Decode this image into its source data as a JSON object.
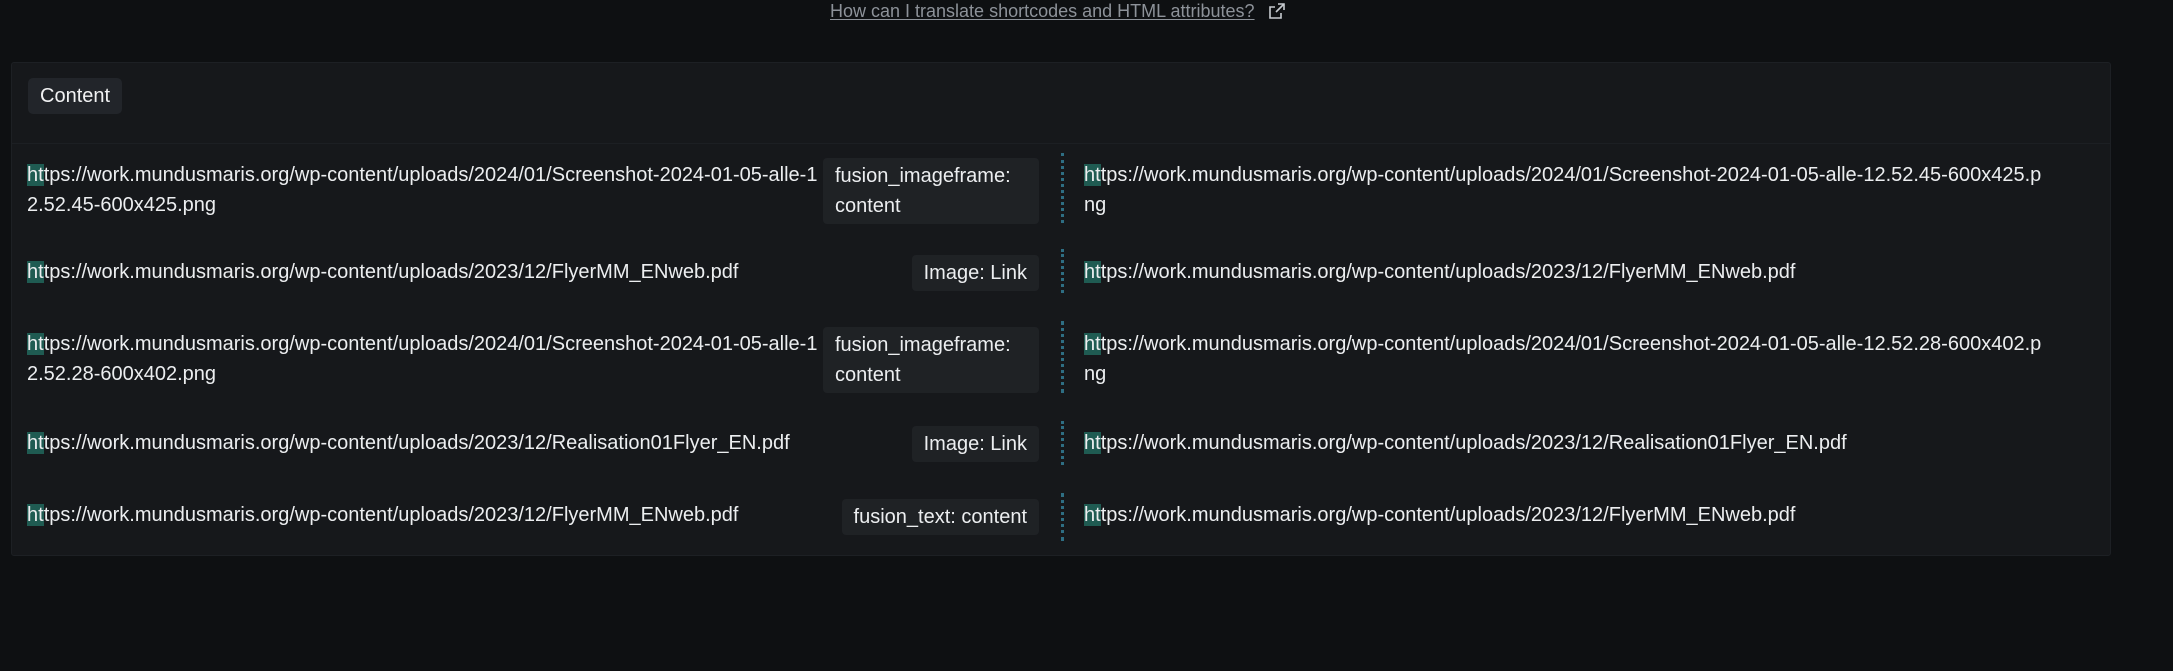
{
  "help": {
    "link_text": "How can I translate shortcodes and HTML attributes?",
    "icon": "external-link-icon"
  },
  "panel": {
    "chip_label": "Content"
  },
  "rows": [
    {
      "source": "https://work.mundusmaris.org/wp-content/uploads/2024/01/Screenshot-2024-01-05-alle-12.52.45-600x425.png",
      "context": "fusion_imageframe: content",
      "target": "https://work.mundusmaris.org/wp-content/uploads/2024/01/Screenshot-2024-01-05-alle-12.52.45-600x425.png"
    },
    {
      "source": "https://work.mundusmaris.org/wp-content/uploads/2023/12/FlyerMM_ENweb.pdf",
      "context": "Image: Link",
      "target": "https://work.mundusmaris.org/wp-content/uploads/2023/12/FlyerMM_ENweb.pdf"
    },
    {
      "source": "https://work.mundusmaris.org/wp-content/uploads/2024/01/Screenshot-2024-01-05-alle-12.52.28-600x402.png",
      "context": "fusion_imageframe: content",
      "target": "https://work.mundusmaris.org/wp-content/uploads/2024/01/Screenshot-2024-01-05-alle-12.52.28-600x402.png"
    },
    {
      "source": "https://work.mundusmaris.org/wp-content/uploads/2023/12/Realisation01Flyer_EN.pdf",
      "context": "Image: Link",
      "target": "https://work.mundusmaris.org/wp-content/uploads/2023/12/Realisation01Flyer_EN.pdf"
    },
    {
      "source": "https://work.mundusmaris.org/wp-content/uploads/2023/12/FlyerMM_ENweb.pdf",
      "context": "fusion_text: content",
      "target": "https://work.mundusmaris.org/wp-content/uploads/2023/12/FlyerMM_ENweb.pdf"
    }
  ],
  "colors": {
    "background": "#0e1012",
    "panel": "#16181b",
    "highlight": "#1f5b52",
    "divider": "#2e6e83"
  }
}
